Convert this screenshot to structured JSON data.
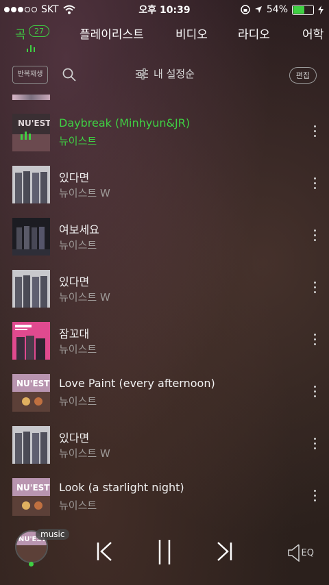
{
  "status": {
    "carrier": "SKT",
    "time": "오후 10:39",
    "battery": "54%",
    "battery_level": 0.54
  },
  "tabs": [
    {
      "label": "곡",
      "count": "27",
      "active": true
    },
    {
      "label": "플레이리스트"
    },
    {
      "label": "비디오"
    },
    {
      "label": "라디오"
    },
    {
      "label": "어학"
    }
  ],
  "toolbar": {
    "repeat_label": "반복재생",
    "sort_label": "내 설정순",
    "edit_label": "편집"
  },
  "songs": [
    {
      "title": "Daybreak (Minhyun&JR)",
      "artist": "뉴이스트",
      "playing": true
    },
    {
      "title": "있다면",
      "artist": "뉴이스트 W"
    },
    {
      "title": "여보세요",
      "artist": "뉴이스트"
    },
    {
      "title": "있다면",
      "artist": "뉴이스트 W"
    },
    {
      "title": "잠꼬대",
      "artist": "뉴이스트"
    },
    {
      "title": "Love Paint (every afternoon)",
      "artist": "뉴이스트"
    },
    {
      "title": "있다면",
      "artist": "뉴이스트 W"
    },
    {
      "title": "Look (a starlight night)",
      "artist": "뉴이스트"
    }
  ],
  "player": {
    "tag": "music",
    "eq_label": "EQ"
  },
  "colors": {
    "accent": "#3fd043",
    "text_secondary": "#9e9a98"
  }
}
